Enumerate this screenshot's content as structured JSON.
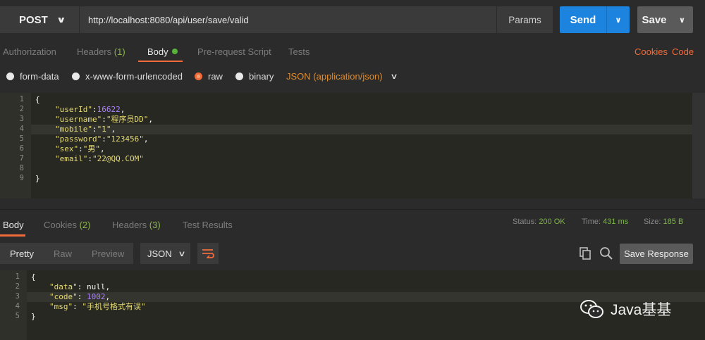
{
  "request": {
    "method": "POST",
    "url": "http://localhost:8080/api/user/save/valid",
    "params_label": "Params",
    "send_label": "Send",
    "save_label": "Save"
  },
  "request_tabs": {
    "authorization": "Authorization",
    "headers": "Headers",
    "headers_count": "(1)",
    "body": "Body",
    "pre_request": "Pre-request Script",
    "tests": "Tests",
    "cookies": "Cookies",
    "code": "Code"
  },
  "body_types": {
    "form_data": "form-data",
    "urlencoded": "x-www-form-urlencoded",
    "raw": "raw",
    "binary": "binary",
    "selected": "raw",
    "content_type": "JSON (application/json)"
  },
  "request_body": {
    "line_numbers": [
      "1",
      "2",
      "3",
      "4",
      "5",
      "6",
      "7",
      "8",
      "9"
    ],
    "open_brace": "{",
    "close_brace": "}",
    "userId_key": "\"userId\"",
    "userId_val": "16622",
    "username_key": "\"username\"",
    "username_val": "\"程序员DD\"",
    "mobile_key": "\"mobile\"",
    "mobile_val": "\"1\"",
    "password_key": "\"password\"",
    "password_val": "\"123456\"",
    "sex_key": "\"sex\"",
    "sex_val": "\"男\"",
    "email_key": "\"email\"",
    "email_val": "\"22@QQ.COM\""
  },
  "response_tabs": {
    "body": "Body",
    "cookies": "Cookies",
    "cookies_count": "(2)",
    "headers": "Headers",
    "headers_count": "(3)",
    "test_results": "Test Results"
  },
  "response_meta": {
    "status_label": "Status:",
    "status_value": "200 OK",
    "time_label": "Time:",
    "time_value": "431 ms",
    "size_label": "Size:",
    "size_value": "185 B"
  },
  "response_view": {
    "pretty": "Pretty",
    "raw": "Raw",
    "preview": "Preview",
    "format": "JSON",
    "save_response": "Save Response"
  },
  "response_body": {
    "line_numbers": [
      "1",
      "2",
      "3",
      "4",
      "5"
    ],
    "open_brace": "{",
    "close_brace": "}",
    "data_key": "\"data\"",
    "data_val": "null",
    "code_key": "\"code\"",
    "code_val": "1002",
    "msg_key": "\"msg\"",
    "msg_val": "\"手机号格式有误\""
  },
  "watermark": {
    "text": "Java基基"
  },
  "colors": {
    "accent_orange": "#f26b3a",
    "send_blue": "#1c84de",
    "status_green": "#79b83f"
  }
}
